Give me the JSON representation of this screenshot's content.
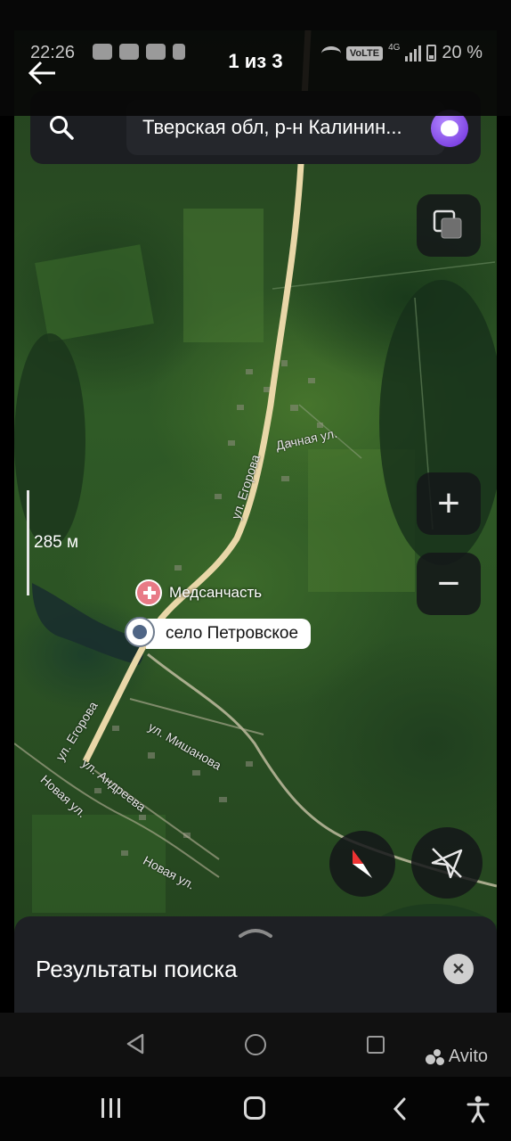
{
  "status_bar": {
    "time": "22:26",
    "network_type": "4G",
    "volte": "VoLTE",
    "battery": "20 %"
  },
  "viewer": {
    "counter": "1 из 3"
  },
  "search": {
    "query": "Тверская обл, р-н Калинин..."
  },
  "map": {
    "scale_label": "285 м",
    "poi": {
      "medical": "Медсанчасть",
      "selected_place": "село Петровское"
    },
    "streets": [
      {
        "key": "egorova_north",
        "label": "ул. Егорова"
      },
      {
        "key": "dachnaya",
        "label": "Дачная ул."
      },
      {
        "key": "egorova_south",
        "label": "ул. Егорова"
      },
      {
        "key": "mishanova",
        "label": "ул. Мишанова"
      },
      {
        "key": "andreeva",
        "label": "ул. Андреева"
      },
      {
        "key": "novaya_west",
        "label": "Новая ул."
      },
      {
        "key": "novaya_south",
        "label": "Новая ул."
      }
    ],
    "zoom_in_symbol": "+",
    "zoom_out_symbol": "−"
  },
  "sheet": {
    "title": "Результаты поиска",
    "close_symbol": "✕"
  },
  "watermark": {
    "brand": "Avito"
  },
  "colors": {
    "road": "#e9d7a8",
    "pin": "#4f6585",
    "medical": "#e87a86",
    "alice": "#7b3ff2"
  }
}
